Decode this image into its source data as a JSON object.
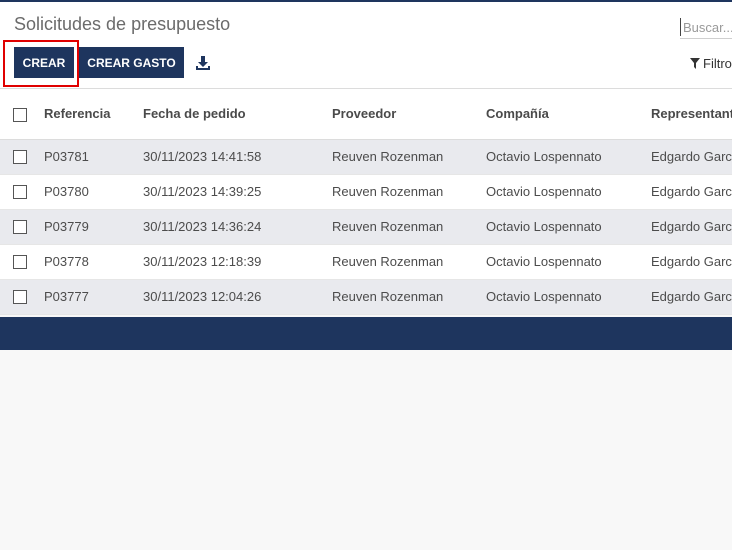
{
  "header": {
    "title": "Solicitudes de presupuesto",
    "search_placeholder": "Buscar..."
  },
  "toolbar": {
    "create_label": "CREAR",
    "create_expense_label": "CREAR GASTO",
    "download_icon": "download-icon",
    "filter_label": "Filtro",
    "filter_icon": "filter-icon"
  },
  "table": {
    "columns": [
      "Referencia",
      "Fecha de pedido",
      "Proveedor",
      "Compañía",
      "Representante"
    ],
    "rows": [
      {
        "ref": "P03781",
        "date": "30/11/2023 14:41:58",
        "vendor": "Reuven Rozenman",
        "company": "Octavio Lospennato",
        "rep": "Edgardo García"
      },
      {
        "ref": "P03780",
        "date": "30/11/2023 14:39:25",
        "vendor": "Reuven Rozenman",
        "company": "Octavio Lospennato",
        "rep": "Edgardo García"
      },
      {
        "ref": "P03779",
        "date": "30/11/2023 14:36:24",
        "vendor": "Reuven Rozenman",
        "company": "Octavio Lospennato",
        "rep": "Edgardo García"
      },
      {
        "ref": "P03778",
        "date": "30/11/2023 12:18:39",
        "vendor": "Reuven Rozenman",
        "company": "Octavio Lospennato",
        "rep": "Edgardo García"
      },
      {
        "ref": "P03777",
        "date": "30/11/2023 12:04:26",
        "vendor": "Reuven Rozenman",
        "company": "Octavio Lospennato",
        "rep": "Edgardo García"
      }
    ]
  },
  "colors": {
    "primary": "#1e355e",
    "highlight": "#e00000",
    "row_alt": "#e9eaee"
  }
}
